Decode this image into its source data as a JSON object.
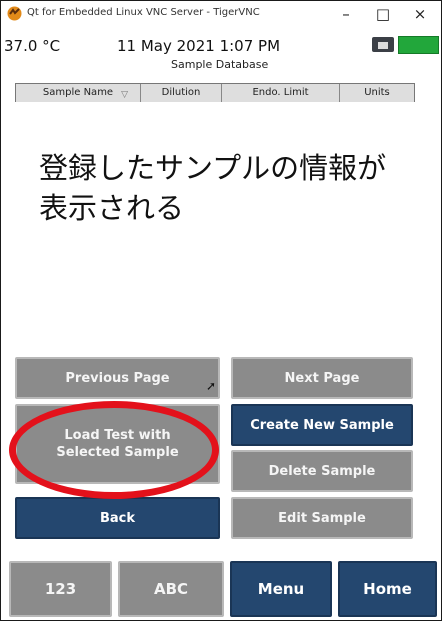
{
  "window": {
    "title": "Qt for Embedded Linux VNC Server - TigerVNC",
    "minimize": "–",
    "maximize": "□",
    "close": "×"
  },
  "status": {
    "temperature": "37.0 °C",
    "datetime": "11 May 2021 1:07 PM",
    "screen_title": "Sample Database",
    "battery_color": "#22a73b"
  },
  "table": {
    "columns": [
      "Sample Name",
      "Dilution",
      "Endo. Limit",
      "Units"
    ]
  },
  "overlay": {
    "line1": "登録したサンプルの情報が",
    "line2": "表示される"
  },
  "buttons": {
    "previous_page": "Previous Page",
    "next_page": "Next Page",
    "load_test": "Load Test with Selected Sample",
    "create_new": "Create New Sample",
    "delete_sample": "Delete Sample",
    "back": "Back",
    "edit_sample": "Edit Sample"
  },
  "bottom_nav": {
    "numeric": "123",
    "alpha": "ABC",
    "menu": "Menu",
    "home": "Home"
  },
  "colors": {
    "blue_button": "#24476f",
    "gray_button": "#8b8b8b",
    "highlight_ellipse": "#e3111b"
  }
}
